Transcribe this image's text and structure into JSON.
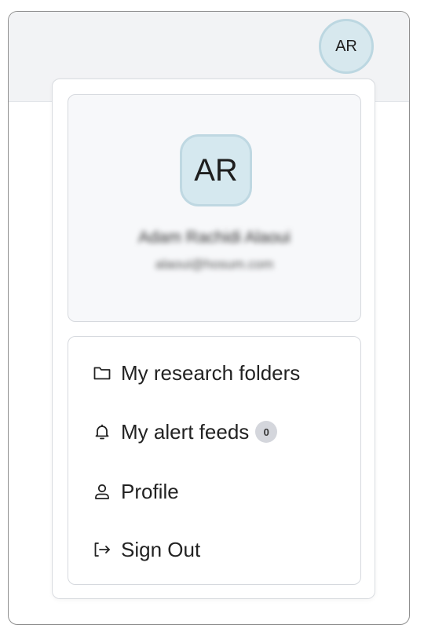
{
  "header": {
    "avatar_initials": "AR"
  },
  "profile": {
    "avatar_initials": "AR",
    "name": "Adam Rachidi Alaoui",
    "email": "alaoui@hosum.com"
  },
  "menu": {
    "items": [
      {
        "label": "My research folders",
        "icon": "folder-icon"
      },
      {
        "label": "My alert feeds",
        "icon": "bell-icon",
        "badge": "0"
      },
      {
        "label": "Profile",
        "icon": "user-icon"
      },
      {
        "label": "Sign Out",
        "icon": "sign-out-icon"
      }
    ]
  },
  "colors": {
    "avatar_bg": "#d7e8ee",
    "avatar_border": "#bcd7e1",
    "topbar_bg": "#f2f3f5",
    "badge_bg": "#d4d6dc"
  }
}
